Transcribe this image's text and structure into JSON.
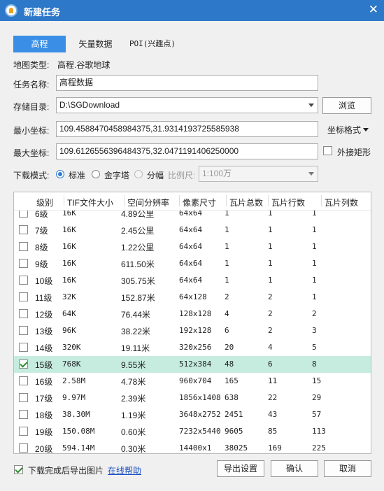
{
  "window": {
    "title": "新建任务",
    "close_glyph": "✕"
  },
  "tabs": [
    "高程",
    "矢量数据",
    "POI(兴趣点)"
  ],
  "map_type": {
    "label": "地图类型:",
    "value": "高程.谷歌地球"
  },
  "task_name": {
    "label": "任务名称:",
    "value": "高程数据"
  },
  "storage": {
    "label": "存储目录:",
    "value": "D:\\SGDownload",
    "browse": "浏览"
  },
  "min_coord": {
    "label": "最小坐标:",
    "value": "109.4588470458984375,31.9314193725585938",
    "format_btn": "坐标格式"
  },
  "max_coord": {
    "label": "最大坐标:",
    "value": "109.6126556396484375,32.0471191406250000",
    "outer_rect": "外接矩形"
  },
  "download_mode": {
    "label": "下载模式:",
    "options": [
      "标准",
      "金字塔",
      "分幅"
    ],
    "scale_label": "比例尺:",
    "scale_value": "1:100万"
  },
  "table": {
    "headers": [
      "级别",
      "TIF文件大小",
      "空间分辨率",
      "像素尺寸",
      "瓦片总数",
      "瓦片行数",
      "瓦片列数"
    ],
    "rows": [
      {
        "checked": false,
        "level": "6级",
        "size": "16K",
        "res": "4.89公里",
        "px": "64x64",
        "total": "1",
        "rows": "1",
        "cols": "1"
      },
      {
        "checked": false,
        "level": "7级",
        "size": "16K",
        "res": "2.45公里",
        "px": "64x64",
        "total": "1",
        "rows": "1",
        "cols": "1"
      },
      {
        "checked": false,
        "level": "8级",
        "size": "16K",
        "res": "1.22公里",
        "px": "64x64",
        "total": "1",
        "rows": "1",
        "cols": "1"
      },
      {
        "checked": false,
        "level": "9级",
        "size": "16K",
        "res": "611.50米",
        "px": "64x64",
        "total": "1",
        "rows": "1",
        "cols": "1"
      },
      {
        "checked": false,
        "level": "10级",
        "size": "16K",
        "res": "305.75米",
        "px": "64x64",
        "total": "1",
        "rows": "1",
        "cols": "1"
      },
      {
        "checked": false,
        "level": "11级",
        "size": "32K",
        "res": "152.87米",
        "px": "64x128",
        "total": "2",
        "rows": "2",
        "cols": "1"
      },
      {
        "checked": false,
        "level": "12级",
        "size": "64K",
        "res": "76.44米",
        "px": "128x128",
        "total": "4",
        "rows": "2",
        "cols": "2"
      },
      {
        "checked": false,
        "level": "13级",
        "size": "96K",
        "res": "38.22米",
        "px": "192x128",
        "total": "6",
        "rows": "2",
        "cols": "3"
      },
      {
        "checked": false,
        "level": "14级",
        "size": "320K",
        "res": "19.11米",
        "px": "320x256",
        "total": "20",
        "rows": "4",
        "cols": "5"
      },
      {
        "checked": true,
        "level": "15级",
        "size": "768K",
        "res": "9.55米",
        "px": "512x384",
        "total": "48",
        "rows": "6",
        "cols": "8"
      },
      {
        "checked": false,
        "level": "16级",
        "size": "2.58M",
        "res": "4.78米",
        "px": "960x704",
        "total": "165",
        "rows": "11",
        "cols": "15"
      },
      {
        "checked": false,
        "level": "17级",
        "size": "9.97M",
        "res": "2.39米",
        "px": "1856x1408",
        "total": "638",
        "rows": "22",
        "cols": "29"
      },
      {
        "checked": false,
        "level": "18级",
        "size": "38.30M",
        "res": "1.19米",
        "px": "3648x2752",
        "total": "2451",
        "rows": "43",
        "cols": "57"
      },
      {
        "checked": false,
        "level": "19级",
        "size": "150.08M",
        "res": "0.60米",
        "px": "7232x5440",
        "total": "9605",
        "rows": "85",
        "cols": "113"
      },
      {
        "checked": false,
        "level": "20级",
        "size": "594.14M",
        "res": "0.30米",
        "px": "14400x1",
        "total": "38025",
        "rows": "169",
        "cols": "225"
      }
    ]
  },
  "footer": {
    "export_after": "下载完成后导出图片",
    "help": "在线帮助",
    "export_settings": "导出设置",
    "ok": "确认",
    "cancel": "取消"
  },
  "colors": {
    "titlebar": "#2d78c8",
    "tab_active": "#3a8ee6",
    "row_selected": "#c6ece0",
    "link": "#1a4fc4"
  }
}
